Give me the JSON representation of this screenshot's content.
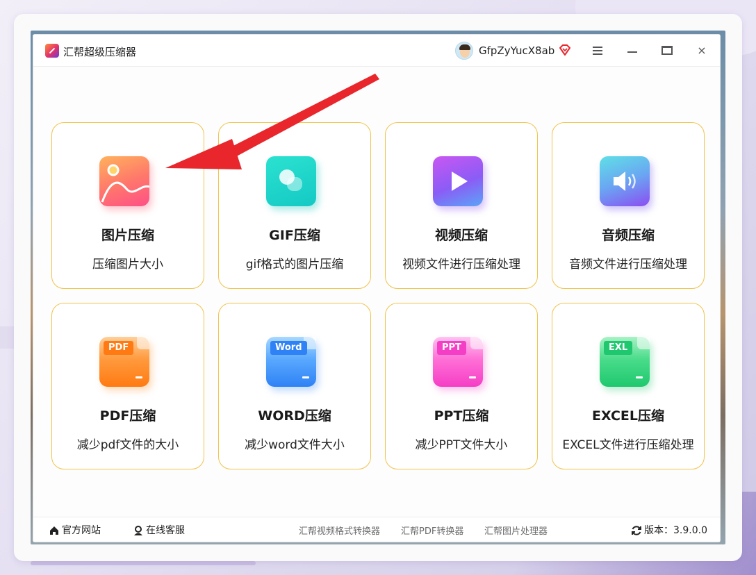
{
  "window": {
    "title": "汇帮超级压缩器",
    "username": "GfpZyYucX8ab",
    "icons": {
      "app": "app-logo-icon",
      "avatar": "user-avatar",
      "vip": "vip-diamond-icon",
      "menu": "hamburger-menu-icon",
      "minimize": "minimize-icon",
      "maximize": "maximize-icon",
      "close": "close-icon"
    },
    "close_glyph": "×"
  },
  "cards": [
    {
      "title": "图片压缩",
      "desc": "压缩图片大小",
      "icon": "image-icon"
    },
    {
      "title": "GIF压缩",
      "desc": "gif格式的图片压缩",
      "icon": "gif-icon"
    },
    {
      "title": "视频压缩",
      "desc": "视频文件进行压缩处理",
      "icon": "video-play-icon"
    },
    {
      "title": "音频压缩",
      "desc": "音频文件进行压缩处理",
      "icon": "audio-speaker-icon"
    },
    {
      "title": "PDF压缩",
      "desc": "减少pdf文件的大小",
      "icon": "pdf-file-icon",
      "tag": "PDF"
    },
    {
      "title": "WORD压缩",
      "desc": "减少word文件大小",
      "icon": "word-file-icon",
      "tag": "Word"
    },
    {
      "title": "PPT压缩",
      "desc": "减少PPT文件大小",
      "icon": "ppt-file-icon",
      "tag": "PPT"
    },
    {
      "title": "EXCEL压缩",
      "desc": "EXCEL文件进行压缩处理",
      "icon": "excel-file-icon",
      "tag": "EXL"
    }
  ],
  "footer": {
    "website": "官方网站",
    "service": "在线客服",
    "links": [
      "汇帮视频格式转换器",
      "汇帮PDF转换器",
      "汇帮图片处理器"
    ],
    "version_label": "版本：3.9.0.0"
  },
  "colors": {
    "card_border": "#f0c34a",
    "annotation_arrow": "#e8262b"
  }
}
